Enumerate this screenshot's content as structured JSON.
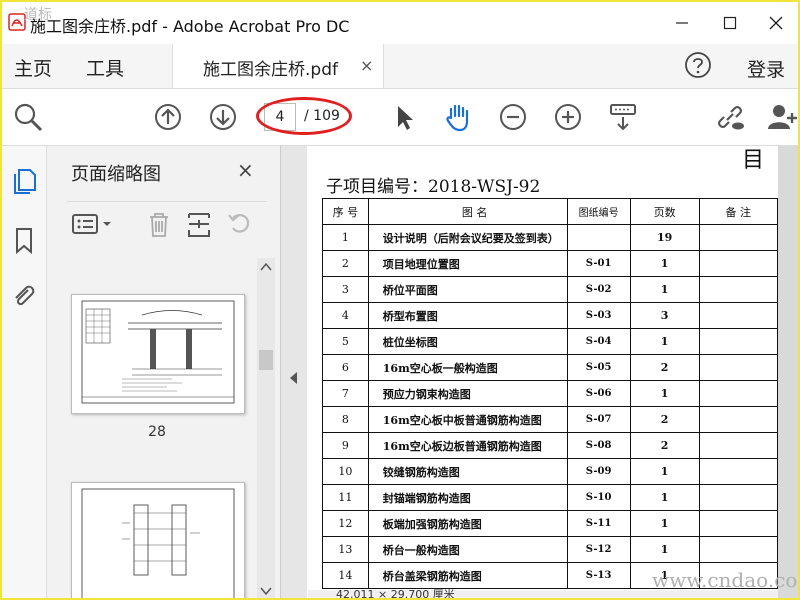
{
  "window": {
    "title": "施工图余庄桥.pdf - Adobe Acrobat Pro DC",
    "watermark_top": "道标"
  },
  "menu": {
    "home": "主页",
    "tools": "工具",
    "tab_label": "施工图余庄桥.pdf",
    "tab_close": "×",
    "login": "登录"
  },
  "toolbar": {
    "page_current": "4",
    "page_total": "/ 109"
  },
  "thumbnails": {
    "title": "页面缩略图",
    "close": "×",
    "items": [
      {
        "label": "28"
      },
      {
        "label": ""
      }
    ]
  },
  "document": {
    "heading": "目",
    "project_no": "子项目编号：2018-WSJ-92",
    "columns": [
      "序 号",
      "图        名",
      "图纸编号",
      "页数",
      "备 注"
    ],
    "rows": [
      {
        "no": "1",
        "name": "设计说明（后附会议纪要及签到表）",
        "code": "",
        "pages": "19"
      },
      {
        "no": "2",
        "name": "项目地理位置图",
        "code": "S-01",
        "pages": "1"
      },
      {
        "no": "3",
        "name": "桥位平面图",
        "code": "S-02",
        "pages": "1"
      },
      {
        "no": "4",
        "name": "桥型布置图",
        "code": "S-03",
        "pages": "3"
      },
      {
        "no": "5",
        "name": "桩位坐标图",
        "code": "S-04",
        "pages": "1"
      },
      {
        "no": "6",
        "name": "16m空心板一般构造图",
        "code": "S-05",
        "pages": "2"
      },
      {
        "no": "7",
        "name": "预应力钢束构造图",
        "code": "S-06",
        "pages": "1"
      },
      {
        "no": "8",
        "name": "16m空心板中板普通钢筋构造图",
        "code": "S-07",
        "pages": "2"
      },
      {
        "no": "9",
        "name": "16m空心板边板普通钢筋构造图",
        "code": "S-08",
        "pages": "2"
      },
      {
        "no": "10",
        "name": "铰缝钢筋构造图",
        "code": "S-09",
        "pages": "1"
      },
      {
        "no": "11",
        "name": "封锚端钢筋构造图",
        "code": "S-10",
        "pages": "1"
      },
      {
        "no": "12",
        "name": "板端加强钢筋构造图",
        "code": "S-11",
        "pages": "1"
      },
      {
        "no": "13",
        "name": "桥台一般构造图",
        "code": "S-12",
        "pages": "1"
      },
      {
        "no": "14",
        "name": "桥台盖梁钢筋构造图",
        "code": "S-13",
        "pages": "1"
      }
    ]
  },
  "status": {
    "dimensions": "42.011 × 29.700 厘米"
  },
  "watermark": "www.cndao.com",
  "colors": {
    "accent": "#1a6fd1",
    "highlight_ellipse": "#e02020",
    "frame": "#f2e53a"
  }
}
